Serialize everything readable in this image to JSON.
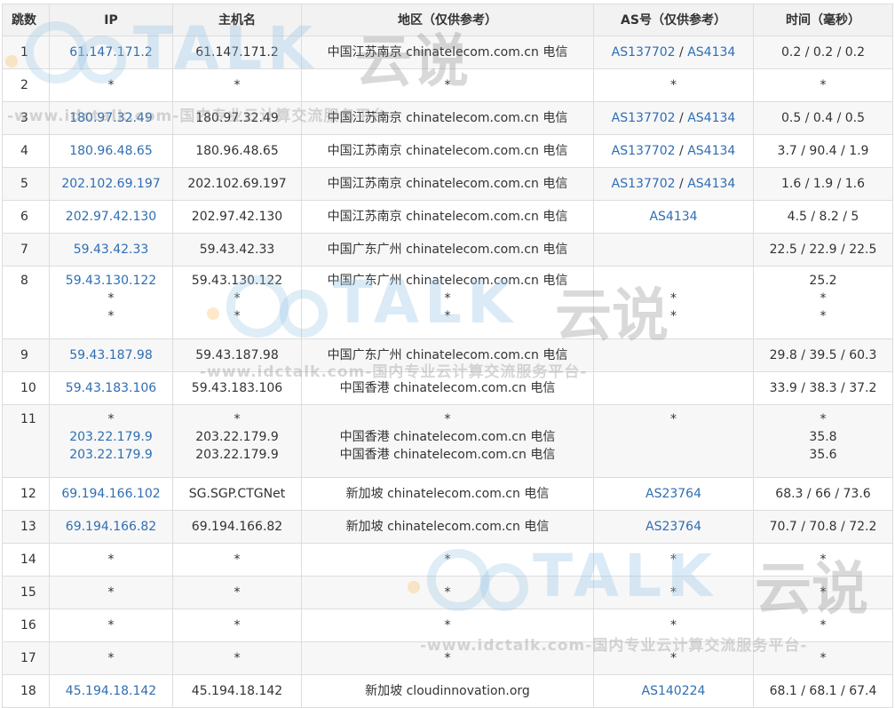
{
  "columns": {
    "hop": "跳数",
    "ip": "IP",
    "hostname": "主机名",
    "region": "地区（仅供参考）",
    "as": "AS号（仅供参考）",
    "time": "时间（毫秒）"
  },
  "rows": [
    {
      "hop": "1",
      "ip": "61.147.171.2",
      "host": "61.147.171.2",
      "region": "中国江苏南京 chinatelecom.com.cn 电信",
      "as1": "AS137702",
      "as2": "AS4134",
      "time": "0.2 / 0.2 / 0.2"
    },
    {
      "hop": "2",
      "ip": "*",
      "host": "*",
      "region": "*",
      "as_text": "*",
      "time": "*"
    },
    {
      "hop": "3",
      "ip": "180.97.32.49",
      "host": "180.97.32.49",
      "region": "中国江苏南京 chinatelecom.com.cn 电信",
      "as1": "AS137702",
      "as2": "AS4134",
      "time": "0.5 / 0.4 / 0.5"
    },
    {
      "hop": "4",
      "ip": "180.96.48.65",
      "host": "180.96.48.65",
      "region": "中国江苏南京 chinatelecom.com.cn 电信",
      "as1": "AS137702",
      "as2": "AS4134",
      "time": "3.7 / 90.4 / 1.9"
    },
    {
      "hop": "5",
      "ip": "202.102.69.197",
      "host": "202.102.69.197",
      "region": "中国江苏南京 chinatelecom.com.cn 电信",
      "as1": "AS137702",
      "as2": "AS4134",
      "time": "1.6 / 1.9 / 1.6"
    },
    {
      "hop": "6",
      "ip": "202.97.42.130",
      "host": "202.97.42.130",
      "region": "中国江苏南京 chinatelecom.com.cn 电信",
      "as1": "AS4134",
      "time": "4.5 / 8.2 / 5"
    },
    {
      "hop": "7",
      "ip": "59.43.42.33",
      "host": "59.43.42.33",
      "region": "中国广东广州 chinatelecom.com.cn 电信",
      "time": "22.5 / 22.9 / 22.5"
    },
    {
      "hop": "8",
      "ip_lines": [
        "59.43.130.122",
        "*",
        "*"
      ],
      "host_lines": [
        "59.43.130.122",
        "*",
        "*"
      ],
      "region_lines": [
        "中国广东广州 chinatelecom.com.cn 电信",
        "*",
        "*"
      ],
      "as_lines": [
        "",
        "*",
        "*"
      ],
      "time_lines": [
        "25.2",
        "*",
        "*"
      ]
    },
    {
      "hop": "9",
      "ip": "59.43.187.98",
      "host": "59.43.187.98",
      "region": "中国广东广州 chinatelecom.com.cn 电信",
      "time": "29.8 / 39.5 / 60.3"
    },
    {
      "hop": "10",
      "ip": "59.43.183.106",
      "host": "59.43.183.106",
      "region": "中国香港 chinatelecom.com.cn 电信",
      "time": "33.9 / 38.3 / 37.2"
    },
    {
      "hop": "11",
      "ip_lines": [
        "*",
        "203.22.179.9",
        "203.22.179.9"
      ],
      "host_lines": [
        "*",
        "203.22.179.9",
        "203.22.179.9"
      ],
      "region_lines": [
        "*",
        "中国香港 chinatelecom.com.cn 电信",
        "中国香港 chinatelecom.com.cn 电信"
      ],
      "as_lines": [
        "*",
        "",
        ""
      ],
      "time_lines": [
        "*",
        "35.8",
        "35.6"
      ]
    },
    {
      "hop": "12",
      "ip": "69.194.166.102",
      "host": "SG.SGP.CTGNet",
      "region": "新加坡 chinatelecom.com.cn 电信",
      "as1": "AS23764",
      "time": "68.3 / 66 / 73.6"
    },
    {
      "hop": "13",
      "ip": "69.194.166.82",
      "host": "69.194.166.82",
      "region": "新加坡 chinatelecom.com.cn 电信",
      "as1": "AS23764",
      "time": "70.7 / 70.8 / 72.2"
    },
    {
      "hop": "14",
      "ip": "*",
      "host": "*",
      "region": "*",
      "as_text": "*",
      "time": "*"
    },
    {
      "hop": "15",
      "ip": "*",
      "host": "*",
      "region": "*",
      "as_text": "*",
      "time": "*"
    },
    {
      "hop": "16",
      "ip": "*",
      "host": "*",
      "region": "*",
      "as_text": "*",
      "time": "*"
    },
    {
      "hop": "17",
      "ip": "*",
      "host": "*",
      "region": "*",
      "as_text": "*",
      "time": "*"
    },
    {
      "hop": "18",
      "ip": "45.194.18.142",
      "host": "45.194.18.142",
      "region": "新加坡 cloudinnovation.org",
      "as1": "AS140224",
      "time": "68.1 / 68.1 / 67.4"
    }
  ],
  "watermark": {
    "logo": "TALK",
    "brand_cn": "云说",
    "url": "-www.idctalk.com-国内专业云计算交流服务平台-"
  },
  "colors": {
    "link": "#2f6eb3",
    "header_bg": "#f2f2f2",
    "stripe": "#f7f7f7",
    "border": "#dddddd"
  }
}
